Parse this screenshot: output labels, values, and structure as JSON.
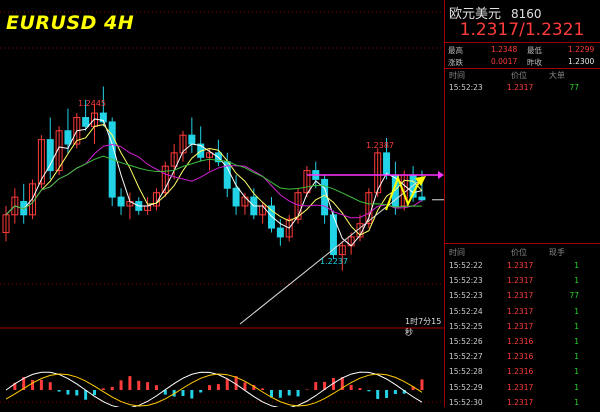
{
  "chart": {
    "title": "EURUSD 4H",
    "high_label": "1.2445",
    "mid_high_label": "1.2387",
    "low_label": "1.2237",
    "timer": "1时7分15秒",
    "colors": {
      "background": "#000000",
      "up_candle": "#ff3b3b",
      "down_candle": "#22d3e6",
      "ma_yellow": "#ffffff",
      "ma_magenta": "#d020d0",
      "ma_green": "#3cc03c",
      "ma_white": "#ffff66",
      "resistance": "#ff33ff",
      "arrow": "#ffff00",
      "trendline": "#dddddd"
    }
  },
  "chart_data": {
    "type": "candlestick",
    "ylim": [
      1.2215,
      1.2475
    ],
    "candles": [
      [
        1.228,
        1.231,
        1.227,
        1.23
      ],
      [
        1.23,
        1.233,
        1.229,
        1.232
      ],
      [
        1.2315,
        1.2335,
        1.229,
        1.23
      ],
      [
        1.23,
        1.234,
        1.2295,
        1.2335
      ],
      [
        1.2335,
        1.239,
        1.233,
        1.2385
      ],
      [
        1.2385,
        1.241,
        1.234,
        1.235
      ],
      [
        1.235,
        1.24,
        1.2345,
        1.2395
      ],
      [
        1.2395,
        1.242,
        1.237,
        1.238
      ],
      [
        1.238,
        1.2415,
        1.2375,
        1.241
      ],
      [
        1.241,
        1.243,
        1.2395,
        1.24
      ],
      [
        1.24,
        1.2425,
        1.238,
        1.2415
      ],
      [
        1.2415,
        1.2445,
        1.24,
        1.2405
      ],
      [
        1.2405,
        1.241,
        1.231,
        1.232
      ],
      [
        1.232,
        1.233,
        1.23,
        1.231
      ],
      [
        1.231,
        1.2325,
        1.2295,
        1.2315
      ],
      [
        1.2315,
        1.232,
        1.23,
        1.2305
      ],
      [
        1.2305,
        1.232,
        1.23,
        1.231
      ],
      [
        1.231,
        1.233,
        1.2305,
        1.2325
      ],
      [
        1.2325,
        1.236,
        1.232,
        1.2355
      ],
      [
        1.2355,
        1.238,
        1.234,
        1.237
      ],
      [
        1.237,
        1.2395,
        1.236,
        1.239
      ],
      [
        1.239,
        1.241,
        1.237,
        1.238
      ],
      [
        1.238,
        1.24,
        1.236,
        1.2365
      ],
      [
        1.2365,
        1.2375,
        1.235,
        1.237
      ],
      [
        1.237,
        1.2385,
        1.2355,
        1.236
      ],
      [
        1.236,
        1.237,
        1.232,
        1.233
      ],
      [
        1.233,
        1.2345,
        1.23,
        1.231
      ],
      [
        1.231,
        1.2325,
        1.23,
        1.232
      ],
      [
        1.232,
        1.233,
        1.2295,
        1.23
      ],
      [
        1.23,
        1.2315,
        1.229,
        1.231
      ],
      [
        1.231,
        1.232,
        1.228,
        1.2285
      ],
      [
        1.2285,
        1.2295,
        1.2265,
        1.2275
      ],
      [
        1.2275,
        1.23,
        1.227,
        1.2295
      ],
      [
        1.2295,
        1.233,
        1.229,
        1.2325
      ],
      [
        1.2325,
        1.2355,
        1.232,
        1.235
      ],
      [
        1.235,
        1.236,
        1.233,
        1.234
      ],
      [
        1.234,
        1.2345,
        1.229,
        1.23
      ],
      [
        1.23,
        1.2305,
        1.225,
        1.2255
      ],
      [
        1.2255,
        1.227,
        1.2237,
        1.2265
      ],
      [
        1.2265,
        1.228,
        1.2255,
        1.2275
      ],
      [
        1.2275,
        1.23,
        1.227,
        1.229
      ],
      [
        1.229,
        1.233,
        1.2285,
        1.2325
      ],
      [
        1.2325,
        1.2375,
        1.232,
        1.237
      ],
      [
        1.237,
        1.2387,
        1.234,
        1.2345
      ],
      [
        1.2345,
        1.236,
        1.23,
        1.231
      ],
      [
        1.231,
        1.235,
        1.2305,
        1.2345
      ],
      [
        1.2345,
        1.2355,
        1.2315,
        1.232
      ],
      [
        1.232,
        1.235,
        1.2315,
        1.2317
      ]
    ],
    "resistance_price": 1.2345,
    "indicator_levels": [
      "1.2348",
      "1.2299"
    ]
  },
  "panel": {
    "name": "欧元美元",
    "code": "8160",
    "price": "1.2317/1.2321",
    "stats": {
      "high_label": "最高",
      "high": "1.2348",
      "low_label": "最低",
      "low": "1.2299",
      "change_label": "涨跌",
      "change": "0.0017",
      "prev_label": "昨收",
      "prev": "1.2300"
    },
    "big_headers": {
      "time": "时间",
      "price": "价位",
      "vol": "大单"
    },
    "big_row": {
      "time": "15:52:23",
      "price": "1.2317",
      "vol": "77"
    },
    "tick_headers": {
      "time": "时间",
      "price": "价位",
      "vol": "现手"
    },
    "ticks": [
      {
        "time": "15:52:22",
        "price": "1.2317",
        "vol": "1"
      },
      {
        "time": "15:52:23",
        "price": "1.2317",
        "vol": "1"
      },
      {
        "time": "15:52:23",
        "price": "1.2317",
        "vol": "77"
      },
      {
        "time": "15:52:24",
        "price": "1.2317",
        "vol": "1"
      },
      {
        "time": "15:52:25",
        "price": "1.2317",
        "vol": "1"
      },
      {
        "time": "15:52:26",
        "price": "1.2316",
        "vol": "1"
      },
      {
        "time": "15:52:27",
        "price": "1.2316",
        "vol": "1"
      },
      {
        "time": "15:52:28",
        "price": "1.2316",
        "vol": "1"
      },
      {
        "time": "15:52:29",
        "price": "1.2317",
        "vol": "1"
      },
      {
        "time": "15:52:30",
        "price": "1.2317",
        "vol": "1"
      }
    ]
  }
}
